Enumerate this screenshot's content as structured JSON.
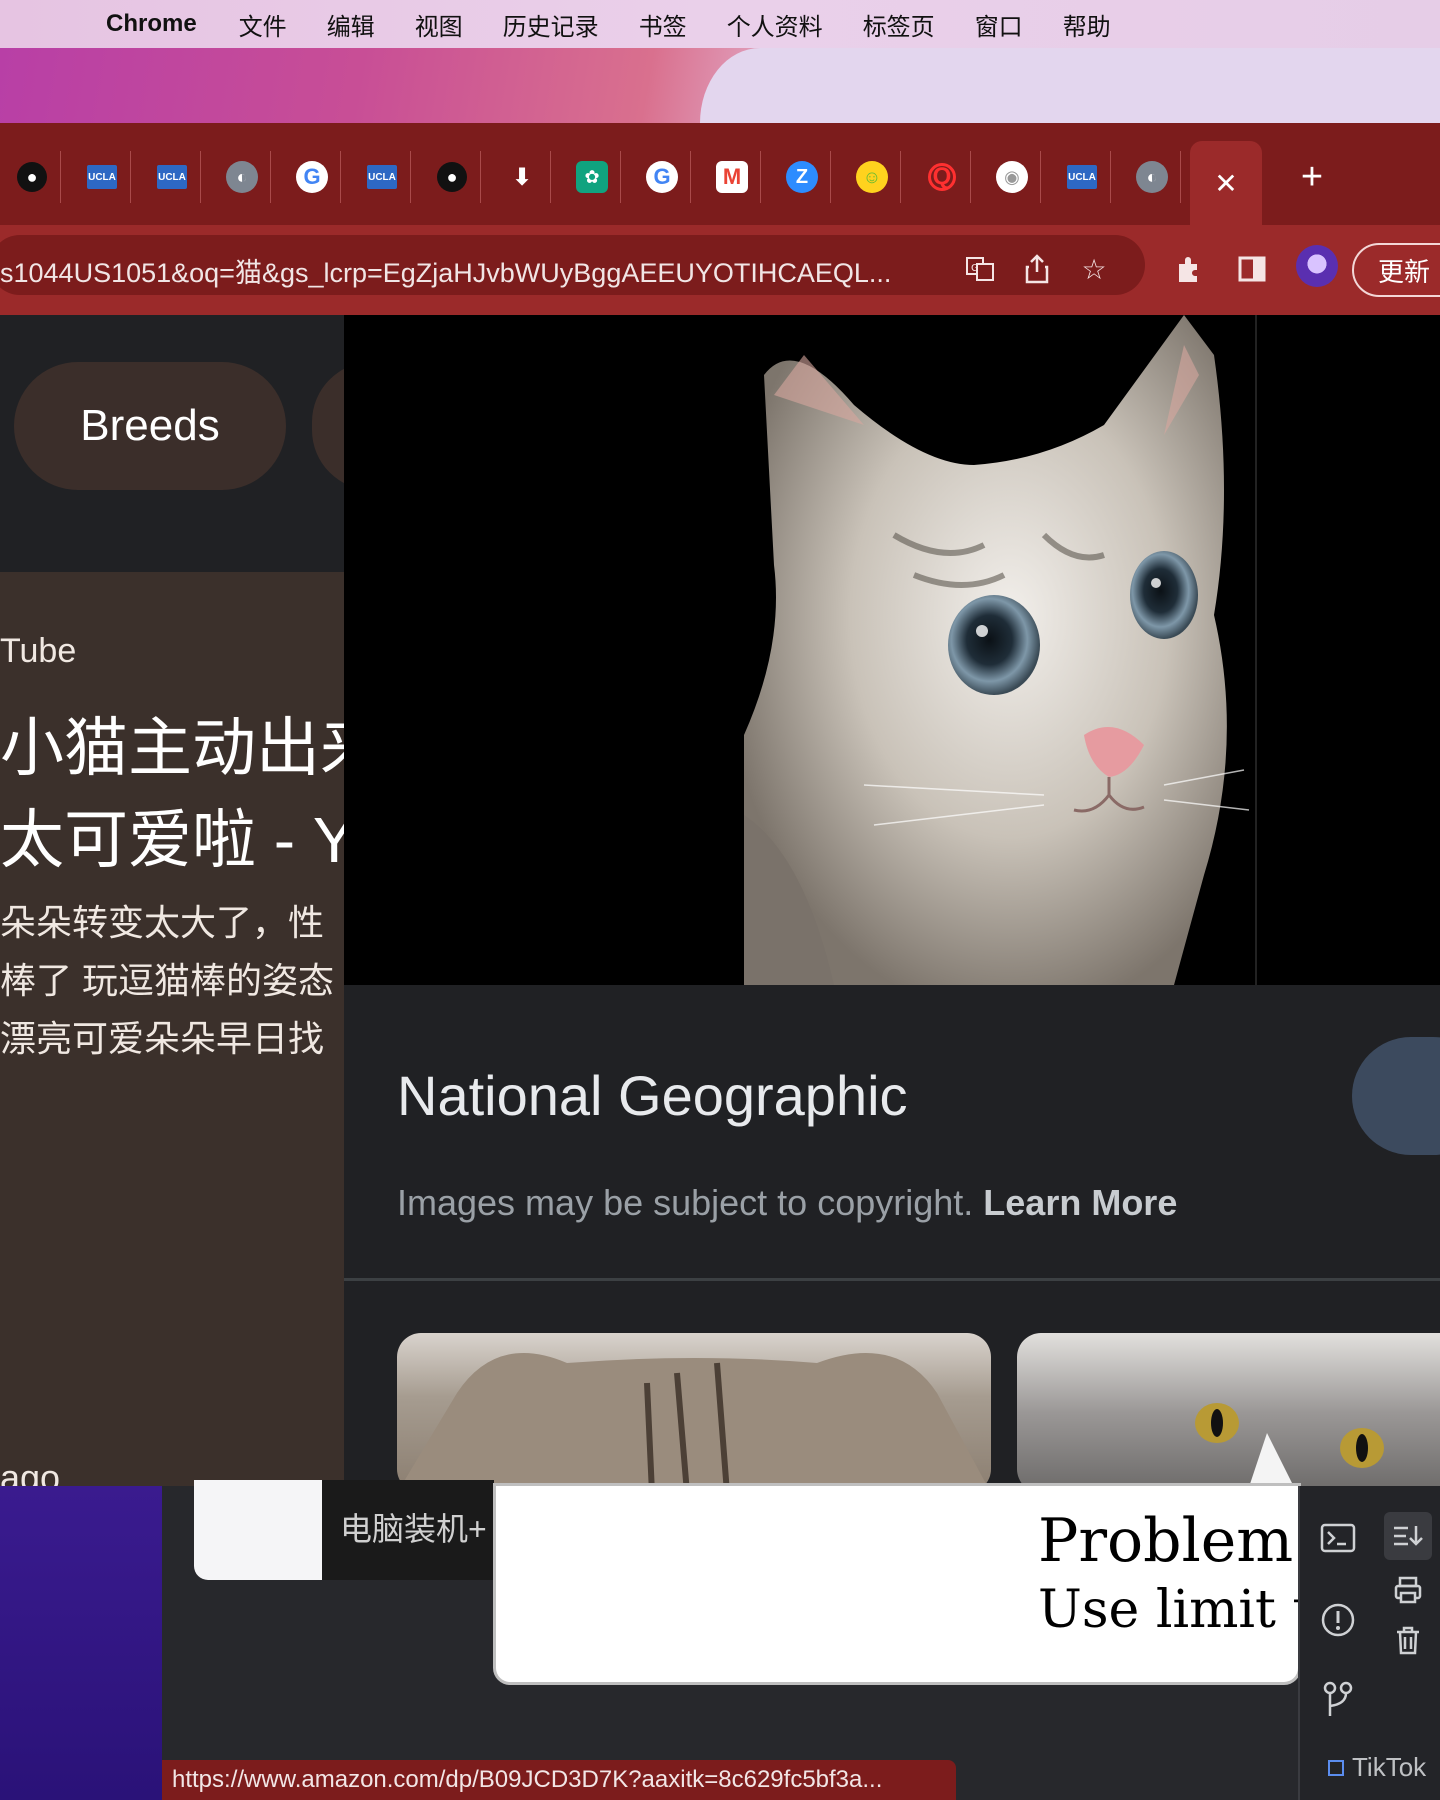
{
  "menubar": {
    "app": "Chrome",
    "items": [
      "文件",
      "编辑",
      "视图",
      "历史记录",
      "书签",
      "个人资料",
      "标签页",
      "窗口",
      "帮助"
    ]
  },
  "tabs": [
    {
      "icon": "github-icon",
      "glyph": "●"
    },
    {
      "icon": "ucla-icon",
      "glyph": "UCLA"
    },
    {
      "icon": "ucla-icon",
      "glyph": "UCLA"
    },
    {
      "icon": "globe-icon",
      "glyph": "◐"
    },
    {
      "icon": "google-icon",
      "glyph": "G"
    },
    {
      "icon": "ucla-icon",
      "glyph": "UCLA"
    },
    {
      "icon": "github-icon",
      "glyph": "●"
    },
    {
      "icon": "download-icon",
      "glyph": "⬇"
    },
    {
      "icon": "chatgpt-icon",
      "glyph": "✿"
    },
    {
      "icon": "google-icon",
      "glyph": "G"
    },
    {
      "icon": "gmail-icon",
      "glyph": "M"
    },
    {
      "icon": "zoom-icon",
      "glyph": "Z"
    },
    {
      "icon": "huggingface-icon",
      "glyph": "☺"
    },
    {
      "icon": "quora-icon",
      "glyph": "Q"
    },
    {
      "icon": "chrome-icon",
      "glyph": "◉"
    },
    {
      "icon": "ucla-icon",
      "glyph": "UCLA"
    },
    {
      "icon": "globe-icon",
      "glyph": "◐"
    }
  ],
  "active_tab_close": "✕",
  "new_tab": "+",
  "omnibox": {
    "url": "s1044US1051&oq=猫&gs_lcrp=EgZjaHJvbWUyBggAEEUYOTIHCAEQL..."
  },
  "toolbar": {
    "update_label": "更新"
  },
  "left_pane": {
    "chips": [
      "Breeds",
      ""
    ],
    "source": "Tube",
    "title_lines": [
      "小猫主动出来",
      "太可爱啦 - Yo"
    ],
    "snippet_lines": [
      "朵朵转变太大了，性",
      "棒了 玩逗猫棒的姿态",
      "漂亮可爱朵朵早日找"
    ],
    "ago": "ago"
  },
  "preview": {
    "source_title": "National Geographic",
    "copyright_text": "Images may be subject to copyright.",
    "learn_more": "Learn More"
  },
  "lower": {
    "mini_title": "电脑装机+",
    "pdf_title": "Problem",
    "pdf_sub": "Use limit t",
    "tiktok": "TikTok",
    "status_url": "https://www.amazon.com/dp/B09JCD3D7K?aaxitk=8c629fc5bf3a..."
  },
  "colors": {
    "tab_bar": "#7c1c1c",
    "toolbar": "#9b2a2a",
    "chip": "#3b2e2a",
    "result_card": "#3b302b"
  }
}
